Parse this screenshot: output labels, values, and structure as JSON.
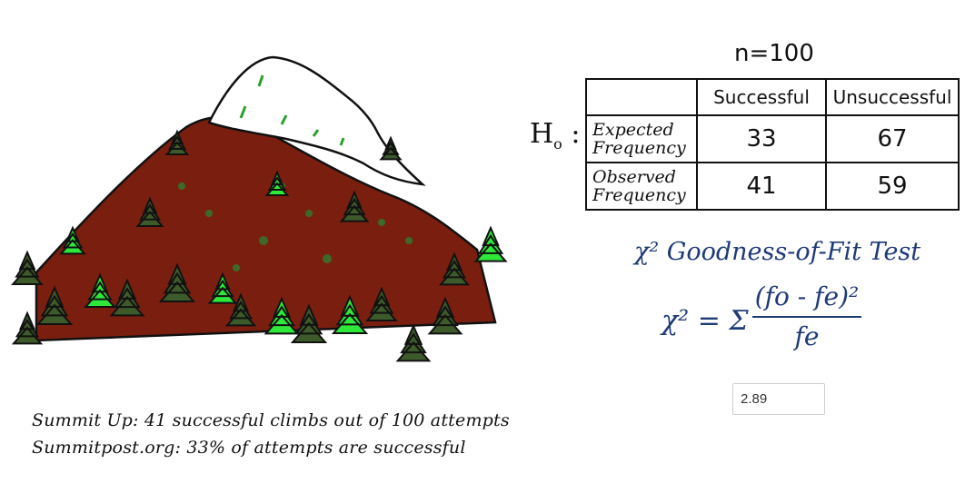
{
  "colors": {
    "mountain": "#7a1f10",
    "snow": "#ffffff",
    "tree_dark": "#3d5a2a",
    "tree_light": "#2ee83a",
    "formula": "#1e3a78"
  },
  "illustration": {
    "icon": "mountain-with-trees-illustration"
  },
  "captions": {
    "line1": "Summit Up: 41 successful climbs out of 100 attempts",
    "line2": "Summitpost.org: 33% of attempts are successful"
  },
  "table": {
    "n_label": "n=100",
    "h0_label": "H",
    "h0_sub": "o",
    "h0_colon": ":",
    "columns": [
      "Successful",
      "Unsuccessful"
    ],
    "rows": [
      {
        "label": "Expected Frequency",
        "values": [
          "33",
          "67"
        ]
      },
      {
        "label": "Observed Frequency",
        "values": [
          "41",
          "59"
        ]
      }
    ]
  },
  "test": {
    "title": "χ² Goodness-of-Fit Test",
    "formula_lhs": "χ² = Σ",
    "numerator": "(fo - fe)²",
    "denominator": "fe"
  },
  "answer": {
    "value": "2.89"
  }
}
